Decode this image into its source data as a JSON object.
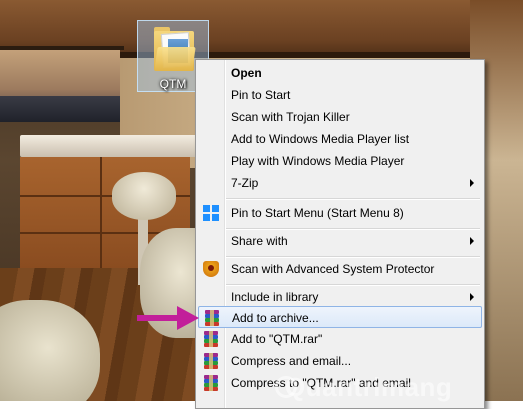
{
  "desktop_icon": {
    "label": "QTM",
    "icon": "folder-icon"
  },
  "context_menu": {
    "items": [
      {
        "label": "Open",
        "bold": true
      },
      {
        "label": "Pin to Start"
      },
      {
        "label": "Scan with Trojan Killer"
      },
      {
        "label": "Add to Windows Media Player list"
      },
      {
        "label": "Play with Windows Media Player"
      },
      {
        "label": "7-Zip",
        "submenu": true
      },
      {
        "label": "Pin to Start Menu (Start Menu 8)",
        "icon": "windows-logo-icon"
      },
      {
        "label": "Share with",
        "submenu": true
      },
      {
        "label": "Scan with Advanced System Protector",
        "icon": "shield-icon"
      },
      {
        "label": "Include in library",
        "submenu": true
      },
      {
        "label": "Add to archive...",
        "icon": "winrar-icon",
        "highlighted": true
      },
      {
        "label": "Add to \"QTM.rar\"",
        "icon": "winrar-icon"
      },
      {
        "label": "Compress and email...",
        "icon": "winrar-icon"
      },
      {
        "label": "Compress to \"QTM.rar\" and email",
        "icon": "winrar-icon"
      }
    ]
  },
  "annotation": {
    "arrow_color": "#c21f9a"
  },
  "watermark": {
    "text": "Quantrimang"
  },
  "colors": {
    "menu_bg": "#f0f0f0",
    "highlight_border": "#8fb4e6"
  }
}
